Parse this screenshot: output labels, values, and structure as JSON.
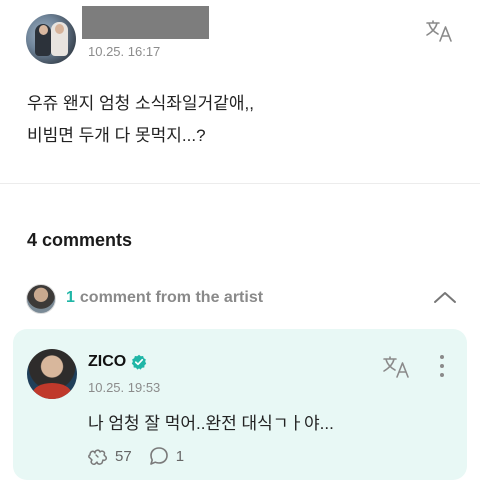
{
  "post": {
    "time": "10.25. 16:17",
    "body_lines": [
      "우쥬 왠지 엄청 소식좌일거같애,,",
      "비빔면 두개 다 못먹지...?"
    ]
  },
  "comments": {
    "count_label": "4 comments",
    "artist_count": "1",
    "artist_label": "comment from the artist"
  },
  "artist_comment": {
    "name": "ZICO",
    "time": "10.25. 19:53",
    "text": "나 엄청 잘 먹어..완전 대식ㄱㅏ야...",
    "likes": "57",
    "replies": "1"
  },
  "colors": {
    "accent": "#1fb6a6",
    "card_bg": "#e8f8f5"
  },
  "icons": [
    "translate-icon",
    "chevron-up-icon",
    "verified-icon",
    "more-vertical-icon",
    "like-icon",
    "reply-icon"
  ]
}
